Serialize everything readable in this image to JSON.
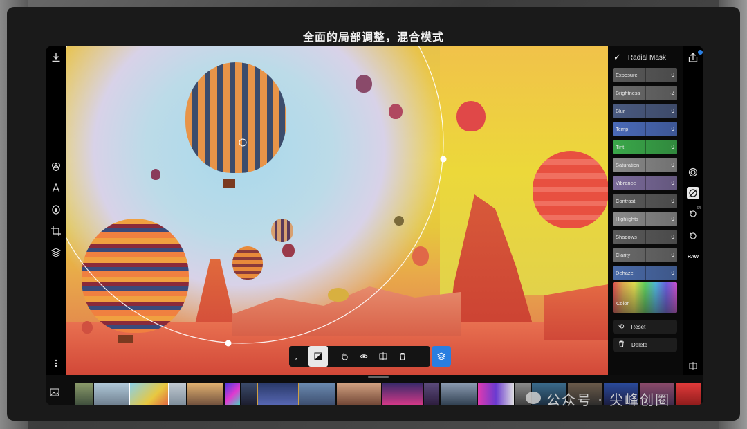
{
  "headline": "全面的局部调整，混合模式",
  "left_rail": {
    "icons": [
      "download-icon",
      "palette-icon",
      "text-icon",
      "retouch-icon",
      "crop-icon",
      "layers-icon",
      "more-icon"
    ]
  },
  "panel": {
    "title": "Radial Mask",
    "sliders": [
      {
        "label": "Exposure",
        "value": "0",
        "color": "#5a5a5a"
      },
      {
        "label": "Brightness",
        "value": "-2",
        "color": "#6a6a6a"
      },
      {
        "label": "Blur",
        "value": "0",
        "color": "#4a5a80"
      },
      {
        "label": "Temp",
        "value": "0",
        "color": "#4a6ab8"
      },
      {
        "label": "Tint",
        "value": "0",
        "color": "#3aa84a"
      },
      {
        "label": "Saturation",
        "value": "0",
        "color": "#8a8a8a"
      },
      {
        "label": "Vibrance",
        "value": "0",
        "color": "#7a6a9a"
      },
      {
        "label": "Contrast",
        "value": "0",
        "color": "#5a5a5a"
      },
      {
        "label": "Highlights",
        "value": "0",
        "color": "#8a8a8a"
      },
      {
        "label": "Shadows",
        "value": "0",
        "color": "#5a5a5a"
      },
      {
        "label": "Clarity",
        "value": "0",
        "color": "#6a6a6a"
      },
      {
        "label": "Dehaze",
        "value": "0",
        "color": "#4a6aa8"
      }
    ],
    "color_label": "Color",
    "reset_label": "Reset",
    "delete_label": "Delete"
  },
  "right_rail": {
    "raw_label": "RAW",
    "history_count": "64"
  },
  "watermark": "公众号 · 尖峰创圈"
}
